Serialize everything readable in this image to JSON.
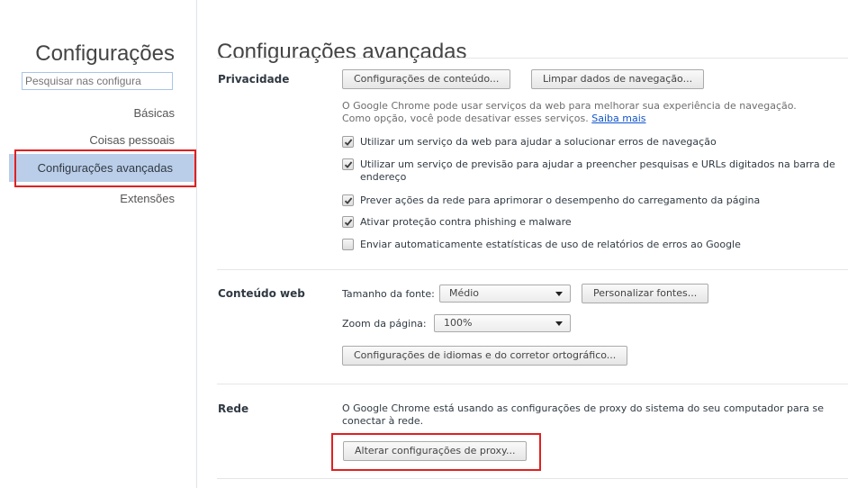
{
  "sidebar": {
    "title": "Configurações",
    "search_placeholder": "Pesquisar nas configura",
    "items": [
      {
        "label": "Básicas"
      },
      {
        "label": "Coisas pessoais"
      },
      {
        "label": "Configurações avançadas"
      },
      {
        "label": "Extensões"
      }
    ]
  },
  "main": {
    "title": "Configurações avançadas",
    "privacy": {
      "title": "Privacidade",
      "content_settings_button": "Configurações de conteúdo...",
      "clear_data_button": "Limpar dados de navegação...",
      "description_line1": "O Google Chrome pode usar serviços da web para melhorar sua experiência de navegação.",
      "description_line2": "Como opção, você pode desativar esses serviços.",
      "learn_more": "Saiba mais",
      "options": [
        {
          "label": "Utilizar um serviço da web para ajudar a solucionar erros de navegação",
          "checked": true
        },
        {
          "label": "Utilizar um serviço de previsão para ajudar a preencher pesquisas e URLs digitados na barra de endereço",
          "checked": true
        },
        {
          "label": "Prever ações da rede para aprimorar o desempenho do carregamento da página",
          "checked": true
        },
        {
          "label": "Ativar proteção contra phishing e malware",
          "checked": true
        },
        {
          "label": "Enviar automaticamente estatísticas de uso de relatórios de erros ao Google",
          "checked": false
        }
      ]
    },
    "web_content": {
      "title": "Conteúdo web",
      "font_size_label": "Tamanho da fonte:",
      "font_size_value": "Médio",
      "customize_fonts_button": "Personalizar fontes...",
      "zoom_label": "Zoom da página:",
      "zoom_value": "100%",
      "languages_button": "Configurações de idiomas e do corretor ortográfico..."
    },
    "network": {
      "title": "Rede",
      "description": "O Google Chrome está usando as configurações de proxy do sistema do seu computador para se conectar à rede.",
      "proxy_button": "Alterar configurações de proxy..."
    }
  },
  "colors": {
    "selected_nav_bg": "#bbcee9",
    "highlight_box": "#e02020",
    "link": "#1155cc"
  }
}
